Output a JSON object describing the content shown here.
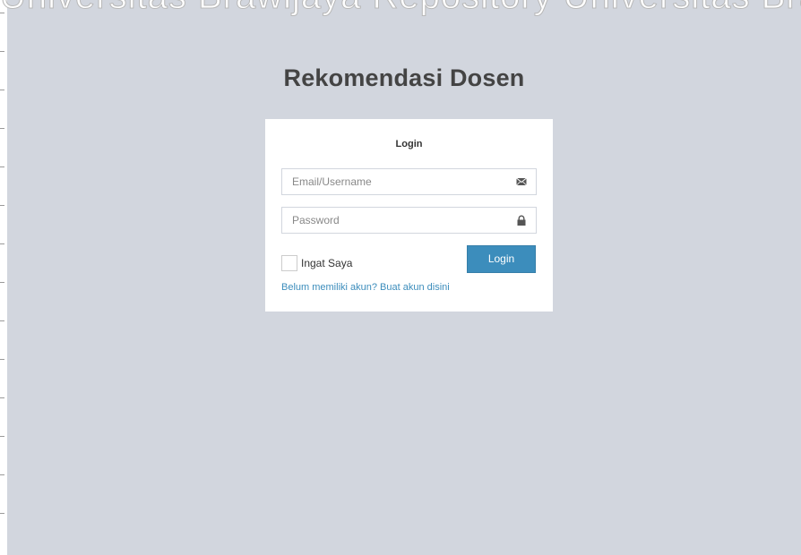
{
  "watermark": {
    "text": "Universitas Brawijaya    Repository Universitas Brawijaya"
  },
  "app": {
    "title": "Rekomendasi Dosen"
  },
  "login": {
    "heading": "Login",
    "email_placeholder": "Email/Username",
    "password_placeholder": "Password",
    "remember_label": "Ingat Saya",
    "remember_checked": false,
    "submit_label": "Login",
    "register_link": "Belum memiliki akun? Buat akun disini"
  },
  "icons": {
    "email": "envelope-icon",
    "password": "lock-icon"
  },
  "colors": {
    "background": "#d2d6de",
    "primary": "#3c8dbc",
    "title": "#444444"
  }
}
